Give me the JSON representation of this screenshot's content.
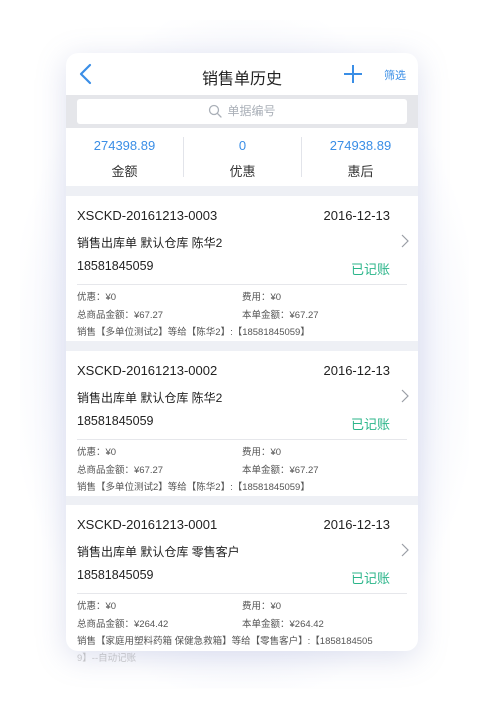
{
  "header": {
    "title": "销售单历史",
    "filter_label": "筛选"
  },
  "search": {
    "placeholder": "单据编号"
  },
  "stats": [
    {
      "value": "274398.89",
      "label": "金额"
    },
    {
      "value": "0",
      "label": "优惠"
    },
    {
      "value": "274938.89",
      "label": "惠后"
    }
  ],
  "orders": [
    {
      "number": "XSCKD-20161213-0003",
      "date": "2016-12-13",
      "description": "销售出库单 默认仓库 陈华2",
      "phone": "18581845059",
      "status": "已记账",
      "discount": "优惠：¥0",
      "fee": "费用：¥0",
      "goods_total": "总商品金额：¥67.27",
      "order_total": "本单金额：¥67.27",
      "summary": "销售【多单位测试2】等给【陈华2】:【18581845059】"
    },
    {
      "number": "XSCKD-20161213-0002",
      "date": "2016-12-13",
      "description": "销售出库单 默认仓库 陈华2",
      "phone": "18581845059",
      "status": "已记账",
      "discount": "优惠：¥0",
      "fee": "费用：¥0",
      "goods_total": "总商品金额：¥67.27",
      "order_total": "本单金额：¥67.27",
      "summary": "销售【多单位测试2】等给【陈华2】:【18581845059】"
    },
    {
      "number": "XSCKD-20161213-0001",
      "date": "2016-12-13",
      "description": "销售出库单 默认仓库 零售客户",
      "phone": "18581845059",
      "status": "已记账",
      "discount": "优惠：¥0",
      "fee": "费用：¥0",
      "goods_total": "总商品金额：¥264.42",
      "order_total": "本单金额：¥264.42",
      "summary": "销售【家庭用塑料药箱 保健急救箱】等给【零售客户】:【1858184505",
      "summary_overflow": "9】--自动记账"
    }
  ],
  "colors": {
    "accent": "#3a8ee6",
    "status": "#2bb58a"
  },
  "icons": [
    "back-arrow-icon",
    "plus-icon",
    "search-icon",
    "chevron-right-icon"
  ]
}
